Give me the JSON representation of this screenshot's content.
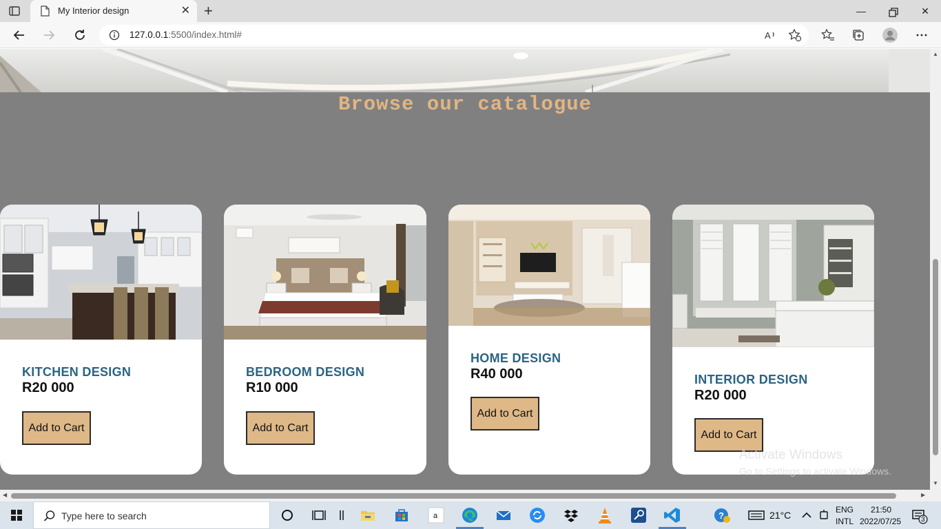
{
  "browser": {
    "tab_title": "My Interior design",
    "url_host": "127.0.0.1",
    "url_rest": ":5500/index.html#"
  },
  "page": {
    "section_title": "Browse our catalogue",
    "cards": [
      {
        "name": "KITCHEN DESIGN",
        "price": "R20 000",
        "button": "Add to Cart"
      },
      {
        "name": "BEDROOM DESIGN",
        "price": "R10 000",
        "button": "Add to Cart"
      },
      {
        "name": "HOME DESIGN",
        "price": "R40 000",
        "button": "Add to Cart"
      },
      {
        "name": "INTERIOR DESIGN",
        "price": "R20 000",
        "button": "Add to Cart"
      }
    ]
  },
  "watermark": {
    "title": "Activate Windows",
    "subtitle": "Go to Settings to activate Windows."
  },
  "taskbar": {
    "search_placeholder": "Type here to search",
    "temperature": "21°C",
    "lang_top": "ENG",
    "lang_bottom": "INTL",
    "time": "21:50",
    "date": "2022/07/25",
    "notification_count": "3"
  },
  "colors": {
    "page_bg": "#808080",
    "title": "#e1b583",
    "card_name": "#2a6483",
    "button_bg": "#deb887"
  }
}
